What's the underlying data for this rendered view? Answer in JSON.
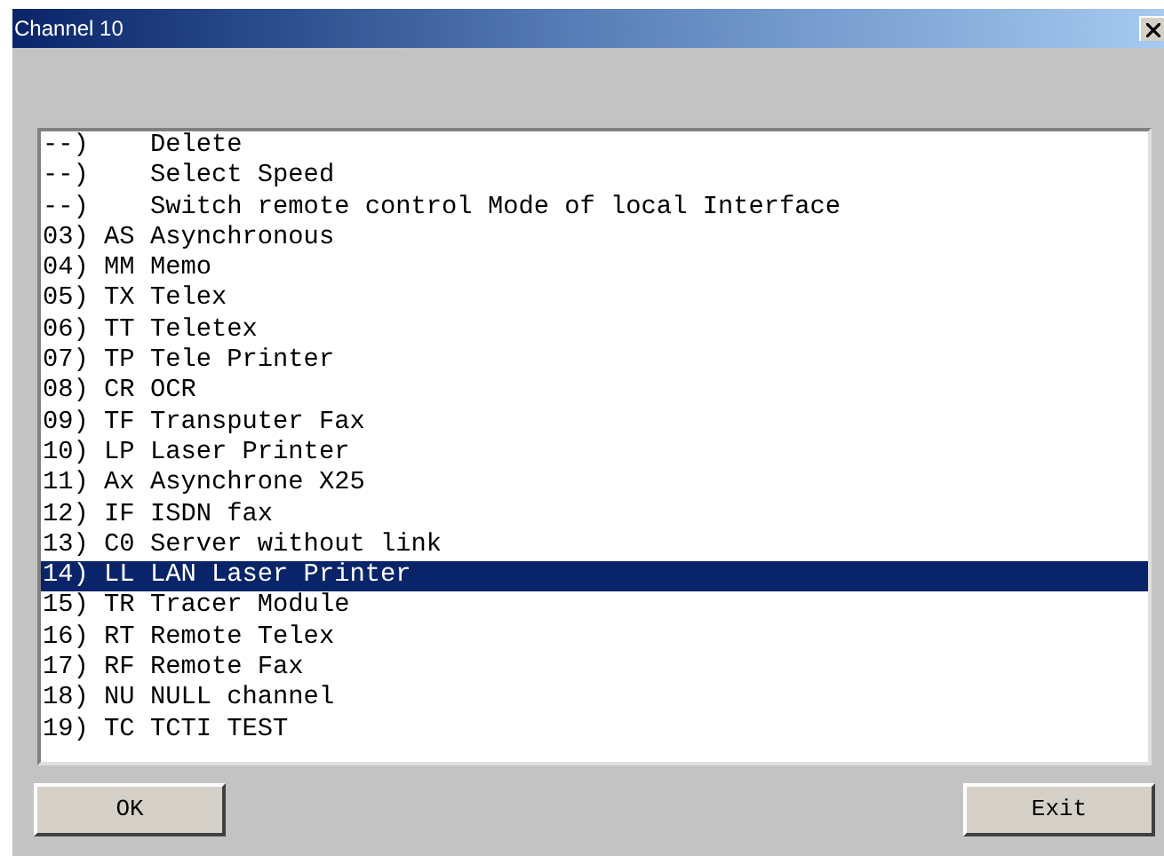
{
  "window": {
    "title": "Channel 10"
  },
  "list": [
    {
      "text": "--)    Delete",
      "selected": false
    },
    {
      "text": "--)    Select Speed",
      "selected": false
    },
    {
      "text": "--)    Switch remote control Mode of local Interface",
      "selected": false
    },
    {
      "text": "03) AS Asynchronous",
      "selected": false
    },
    {
      "text": "04) MM Memo",
      "selected": false
    },
    {
      "text": "05) TX Telex",
      "selected": false
    },
    {
      "text": "06) TT Teletex",
      "selected": false
    },
    {
      "text": "07) TP Tele Printer",
      "selected": false
    },
    {
      "text": "08) CR OCR",
      "selected": false
    },
    {
      "text": "09) TF Transputer Fax",
      "selected": false
    },
    {
      "text": "10) LP Laser Printer",
      "selected": false
    },
    {
      "text": "11) Ax Asynchrone X25",
      "selected": false
    },
    {
      "text": "12) IF ISDN fax",
      "selected": false
    },
    {
      "text": "13) C0 Server without link",
      "selected": false
    },
    {
      "text": "14) LL LAN Laser Printer",
      "selected": true
    },
    {
      "text": "15) TR Tracer Module",
      "selected": false
    },
    {
      "text": "16) RT Remote Telex",
      "selected": false
    },
    {
      "text": "17) RF Remote Fax",
      "selected": false
    },
    {
      "text": "18) NU NULL channel",
      "selected": false
    },
    {
      "text": "19) TC TCTI TEST",
      "selected": false
    }
  ],
  "buttons": [
    "OK",
    "Exit"
  ]
}
